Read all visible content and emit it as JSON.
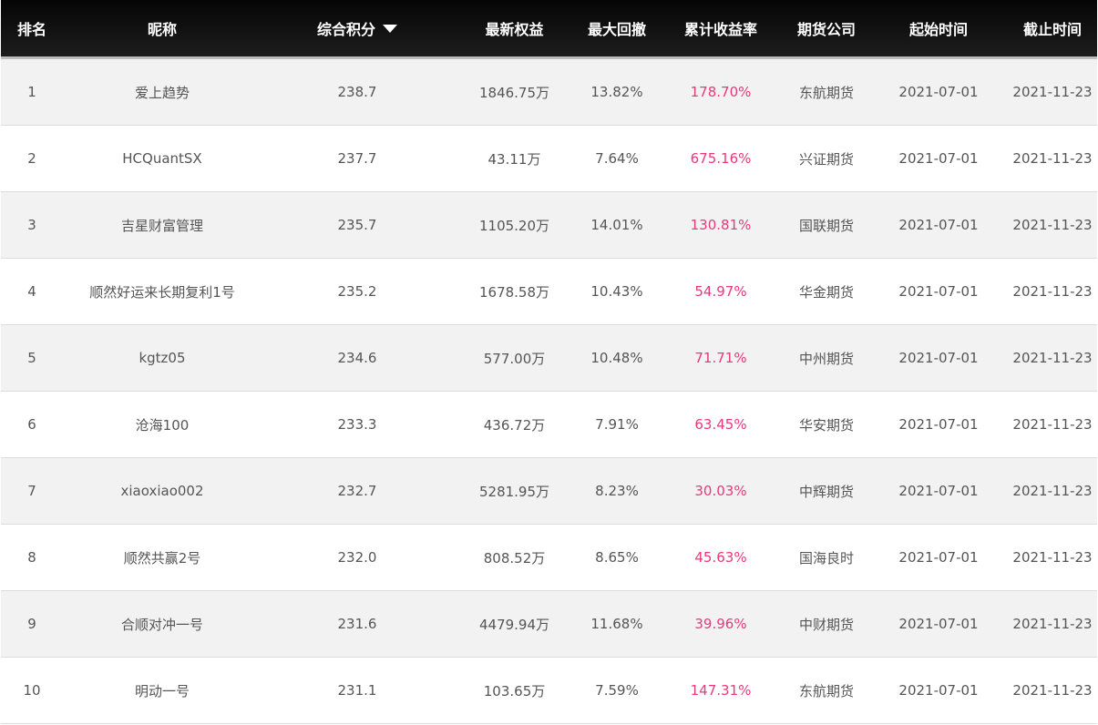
{
  "table": {
    "headers": {
      "rank": "排名",
      "nickname": "昵称",
      "score": "综合积分",
      "equity": "最新权益",
      "drawdown": "最大回撤",
      "return": "累计收益率",
      "company": "期货公司",
      "start": "起始时间",
      "end": "截止时间"
    },
    "sort_icon": "sort-desc-triangle-icon",
    "return_color": "#e8397a",
    "rows": [
      {
        "rank": "1",
        "nickname": "爱上趋势",
        "score": "238.7",
        "equity": "1846.75万",
        "drawdown": "13.82%",
        "return": "178.70%",
        "company": "东航期货",
        "start": "2021-07-01",
        "end": "2021-11-23"
      },
      {
        "rank": "2",
        "nickname": "HCQuantSX",
        "score": "237.7",
        "equity": "43.11万",
        "drawdown": "7.64%",
        "return": "675.16%",
        "company": "兴证期货",
        "start": "2021-07-01",
        "end": "2021-11-23"
      },
      {
        "rank": "3",
        "nickname": "吉星财富管理",
        "score": "235.7",
        "equity": "1105.20万",
        "drawdown": "14.01%",
        "return": "130.81%",
        "company": "国联期货",
        "start": "2021-07-01",
        "end": "2021-11-23"
      },
      {
        "rank": "4",
        "nickname": "顺然好运来长期复利1号",
        "score": "235.2",
        "equity": "1678.58万",
        "drawdown": "10.43%",
        "return": "54.97%",
        "company": "华金期货",
        "start": "2021-07-01",
        "end": "2021-11-23"
      },
      {
        "rank": "5",
        "nickname": "kgtz05",
        "score": "234.6",
        "equity": "577.00万",
        "drawdown": "10.48%",
        "return": "71.71%",
        "company": "中州期货",
        "start": "2021-07-01",
        "end": "2021-11-23"
      },
      {
        "rank": "6",
        "nickname": "沧海100",
        "score": "233.3",
        "equity": "436.72万",
        "drawdown": "7.91%",
        "return": "63.45%",
        "company": "华安期货",
        "start": "2021-07-01",
        "end": "2021-11-23"
      },
      {
        "rank": "7",
        "nickname": "xiaoxiao002",
        "score": "232.7",
        "equity": "5281.95万",
        "drawdown": "8.23%",
        "return": "30.03%",
        "company": "中辉期货",
        "start": "2021-07-01",
        "end": "2021-11-23"
      },
      {
        "rank": "8",
        "nickname": "顺然共赢2号",
        "score": "232.0",
        "equity": "808.52万",
        "drawdown": "8.65%",
        "return": "45.63%",
        "company": "国海良时",
        "start": "2021-07-01",
        "end": "2021-11-23"
      },
      {
        "rank": "9",
        "nickname": "合顺对冲一号",
        "score": "231.6",
        "equity": "4479.94万",
        "drawdown": "11.68%",
        "return": "39.96%",
        "company": "中财期货",
        "start": "2021-07-01",
        "end": "2021-11-23"
      },
      {
        "rank": "10",
        "nickname": "明动一号",
        "score": "231.1",
        "equity": "103.65万",
        "drawdown": "7.59%",
        "return": "147.31%",
        "company": "东航期货",
        "start": "2021-07-01",
        "end": "2021-11-23"
      }
    ]
  }
}
